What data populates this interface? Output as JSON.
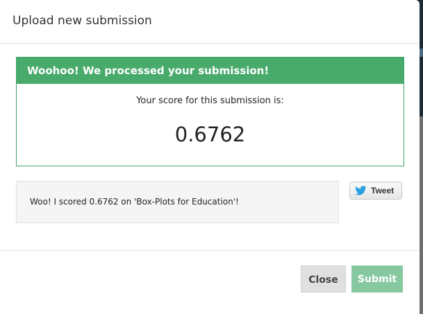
{
  "modal": {
    "title": "Upload new submission"
  },
  "result": {
    "header": "Woohoo! We processed your submission!",
    "score_label": "Your score for this submission is:",
    "score_value": "0.6762"
  },
  "share": {
    "message": "Woo! I scored 0.6762 on 'Box-Plots for Education'!",
    "tweet_label": "Tweet",
    "tweet_icon": "twitter-bird-icon"
  },
  "footer": {
    "close_label": "Close",
    "submit_label": "Submit"
  },
  "colors": {
    "success_green": "#48aa6b",
    "submit_disabled": "#86c9a0",
    "twitter_blue": "#2ba0e0"
  }
}
